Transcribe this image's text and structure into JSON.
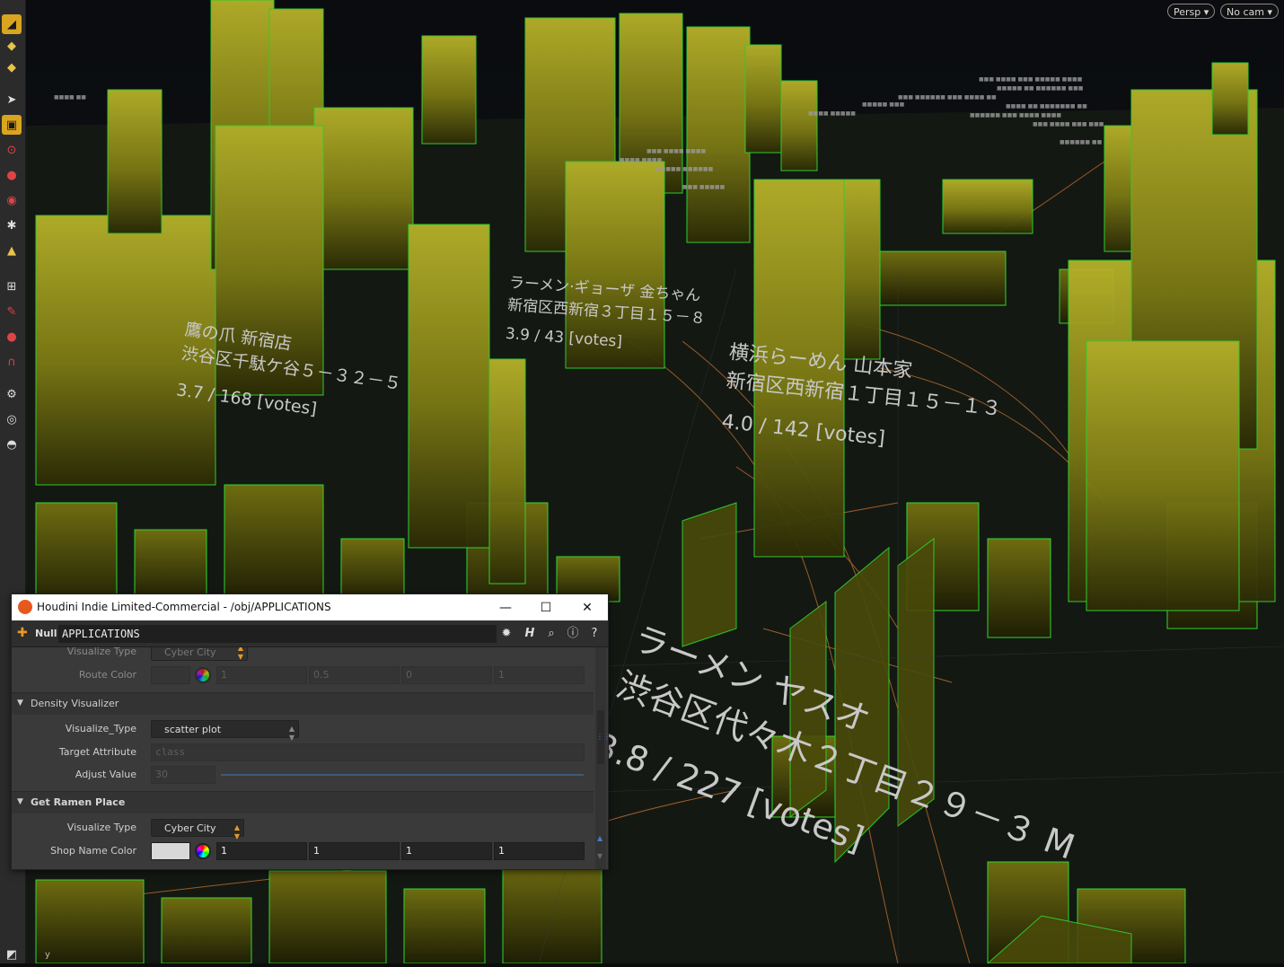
{
  "viewport": {
    "camera_mode": "Persp",
    "camera_select": "No cam",
    "axis_label": "y",
    "labels": [
      {
        "lines": [
          "鷹の爪 新宿店",
          "渋谷区千駄ケ谷５－３２－５",
          "3.7 / 168 [votes]"
        ]
      },
      {
        "lines": [
          "ラーメン·ギョーザ 金ちゃん",
          "新宿区西新宿３丁目１５－８",
          "3.9 / 43 [votes]"
        ]
      },
      {
        "lines": [
          "横浜らーめん 山本家",
          "新宿区西新宿１丁目１５－１３",
          "4.0 / 142 [votes]"
        ]
      },
      {
        "lines": [
          "ラーメン ヤスオ",
          "渋谷区代々木２丁目２９－３ M",
          "3.8 / 227 [votes]"
        ]
      }
    ]
  },
  "toolbar": {
    "tools": [
      "select-icon",
      "move-icon",
      "view-icon",
      "pointer-icon",
      "lock-icon",
      "magnet-icon",
      "sphere-icon",
      "handle-icon",
      "pose-icon",
      "transform-icon",
      "snap-icon",
      "light-icon",
      "camera-icon",
      "bone-icon",
      "chain-icon",
      "key-icon",
      "render-icon",
      "snapshot-icon",
      "shader-icon"
    ]
  },
  "window": {
    "title": "Houdini Indie Limited-Commercial - /obj/APPLICATIONS",
    "minimize": "—",
    "maximize": "☐",
    "close": "✕"
  },
  "node": {
    "type": "Null",
    "name": "APPLICATIONS"
  },
  "params": {
    "visualize_type_prev": {
      "label": "Visualize Type",
      "value": "Cyber City"
    },
    "route_color": {
      "label": "Route Color",
      "values": [
        "1",
        "0.5",
        "0",
        "1"
      ]
    },
    "density_section": "Density Visualizer",
    "visualize_type_density": {
      "label": "Visualize_Type",
      "value": "scatter plot"
    },
    "target_attribute": {
      "label": "Target Attribute",
      "value": "class"
    },
    "adjust_value": {
      "label": "Adjust Value",
      "value": "30"
    },
    "ramen_section": "Get Ramen Place",
    "visualize_type": {
      "label": "Visualize Type",
      "value": "Cyber City"
    },
    "shop_name_color": {
      "label": "Shop Name Color",
      "values": [
        "1",
        "1",
        "1",
        "1"
      ],
      "swatch": "#d8d8d8"
    }
  },
  "colors": {
    "building": "#8a8a10",
    "edge": "#2ed82e",
    "road": "#c8742e",
    "accent": "#d9a520"
  }
}
